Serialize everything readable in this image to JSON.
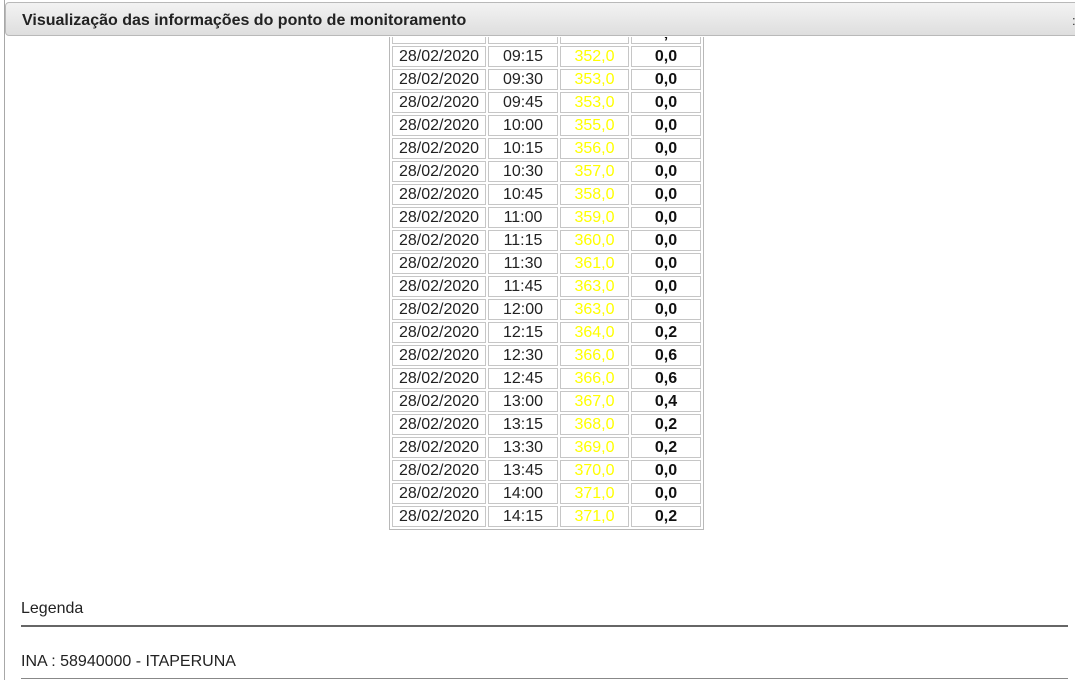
{
  "window": {
    "title": "Visualização das informações do ponto de monitoramento",
    "close_glyph": ":"
  },
  "table": {
    "partial_top_row": {
      "date": "",
      "time": "",
      "level": "",
      "rain": ","
    },
    "rows": [
      {
        "date": "28/02/2020",
        "time": "09:15",
        "level": "352,0",
        "rain": "0,0"
      },
      {
        "date": "28/02/2020",
        "time": "09:30",
        "level": "353,0",
        "rain": "0,0"
      },
      {
        "date": "28/02/2020",
        "time": "09:45",
        "level": "353,0",
        "rain": "0,0"
      },
      {
        "date": "28/02/2020",
        "time": "10:00",
        "level": "355,0",
        "rain": "0,0"
      },
      {
        "date": "28/02/2020",
        "time": "10:15",
        "level": "356,0",
        "rain": "0,0"
      },
      {
        "date": "28/02/2020",
        "time": "10:30",
        "level": "357,0",
        "rain": "0,0"
      },
      {
        "date": "28/02/2020",
        "time": "10:45",
        "level": "358,0",
        "rain": "0,0"
      },
      {
        "date": "28/02/2020",
        "time": "11:00",
        "level": "359,0",
        "rain": "0,0"
      },
      {
        "date": "28/02/2020",
        "time": "11:15",
        "level": "360,0",
        "rain": "0,0"
      },
      {
        "date": "28/02/2020",
        "time": "11:30",
        "level": "361,0",
        "rain": "0,0"
      },
      {
        "date": "28/02/2020",
        "time": "11:45",
        "level": "363,0",
        "rain": "0,0"
      },
      {
        "date": "28/02/2020",
        "time": "12:00",
        "level": "363,0",
        "rain": "0,0"
      },
      {
        "date": "28/02/2020",
        "time": "12:15",
        "level": "364,0",
        "rain": "0,2"
      },
      {
        "date": "28/02/2020",
        "time": "12:30",
        "level": "366,0",
        "rain": "0,6"
      },
      {
        "date": "28/02/2020",
        "time": "12:45",
        "level": "366,0",
        "rain": "0,6"
      },
      {
        "date": "28/02/2020",
        "time": "13:00",
        "level": "367,0",
        "rain": "0,4"
      },
      {
        "date": "28/02/2020",
        "time": "13:15",
        "level": "368,0",
        "rain": "0,2"
      },
      {
        "date": "28/02/2020",
        "time": "13:30",
        "level": "369,0",
        "rain": "0,2"
      },
      {
        "date": "28/02/2020",
        "time": "13:45",
        "level": "370,0",
        "rain": "0,0"
      },
      {
        "date": "28/02/2020",
        "time": "14:00",
        "level": "371,0",
        "rain": "0,0"
      },
      {
        "date": "28/02/2020",
        "time": "14:15",
        "level": "371,0",
        "rain": "0,2"
      }
    ],
    "level_color": "#ffff00"
  },
  "legend": {
    "title": "Legenda",
    "station": "INA : 58940000 - ITAPERUNA"
  }
}
